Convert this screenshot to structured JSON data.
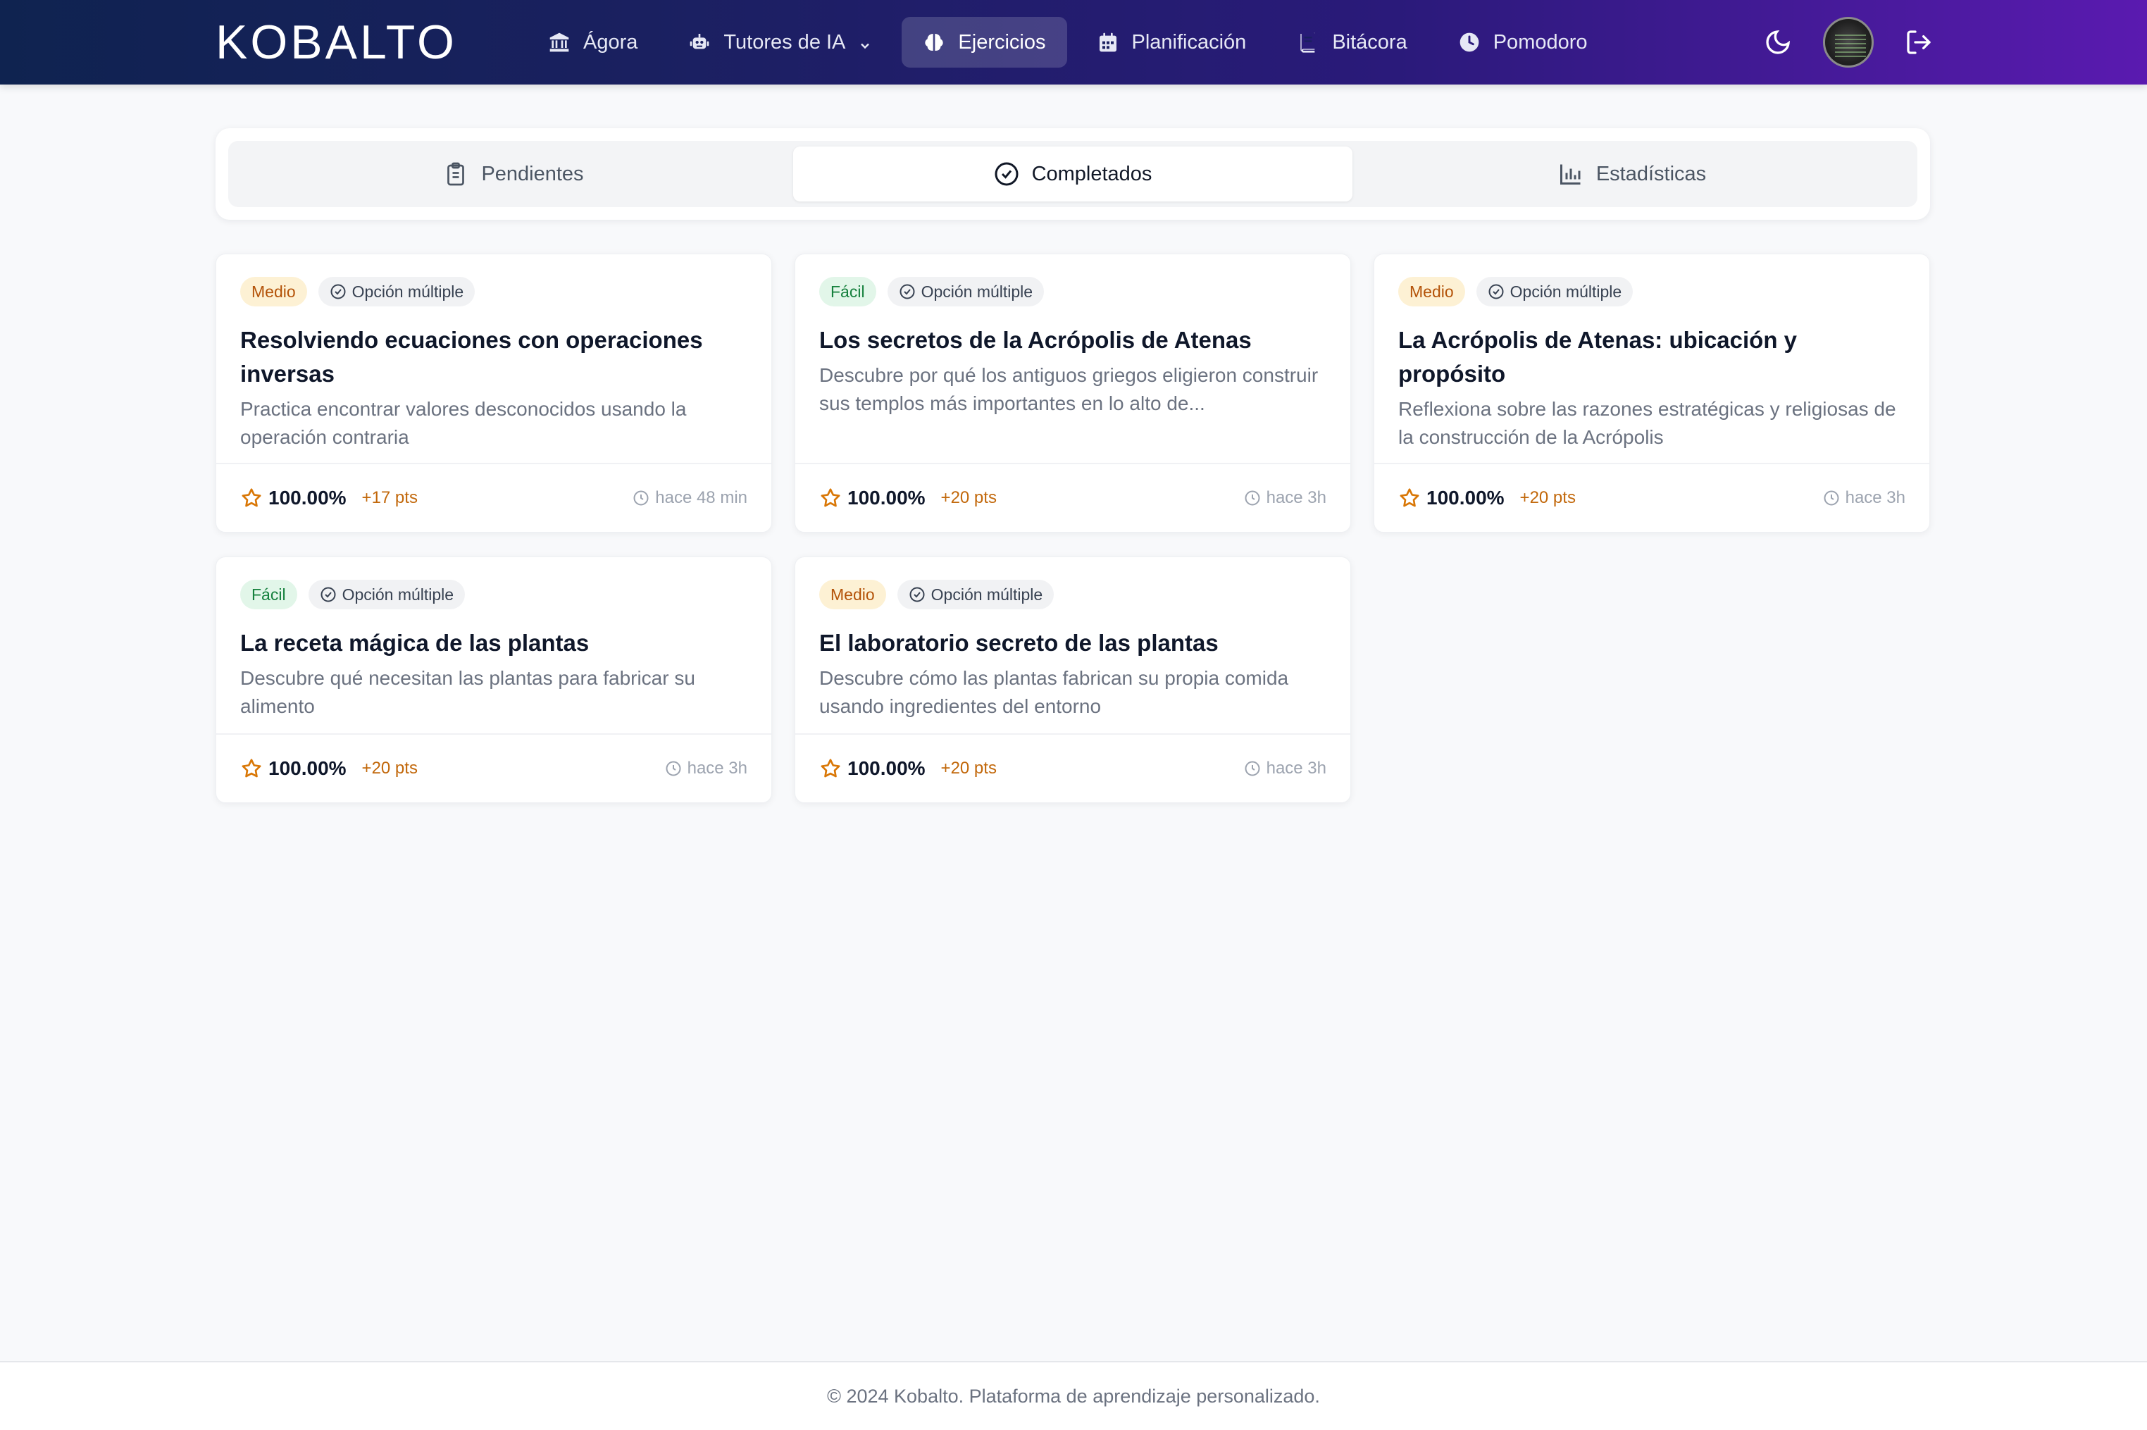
{
  "nav": {
    "logo": "KOBALTO",
    "items": [
      {
        "label": "Ágora",
        "icon": "bank-icon"
      },
      {
        "label": "Tutores de IA",
        "icon": "robot-icon"
      },
      {
        "label": "Ejercicios",
        "icon": "brain-icon",
        "active": true
      },
      {
        "label": "Planificación",
        "icon": "calendar-icon"
      },
      {
        "label": "Bitácora",
        "icon": "book-icon"
      },
      {
        "label": "Pomodoro",
        "icon": "clock-icon"
      }
    ],
    "right": [
      "moon-icon",
      "avatar",
      "logout-icon"
    ]
  },
  "tabs": [
    {
      "label": "Pendientes",
      "icon": "clipboard-icon"
    },
    {
      "label": "Completados",
      "icon": "check-circle-icon",
      "active": true
    },
    {
      "label": "Estadísticas",
      "icon": "bar-chart-icon"
    }
  ],
  "cards": [
    {
      "difficulty": "Medio",
      "type": "Opción múltiple",
      "title": "Resolviendo ecuaciones con operaciones inversas",
      "description": "Practica encontrar valores desconocidos usando la operación contraria",
      "score": "100.00%",
      "points": "+17 pts",
      "time": "hace 48 min"
    },
    {
      "difficulty": "Fácil",
      "type": "Opción múltiple",
      "title": "Los secretos de la Acrópolis de Atenas",
      "description": "Descubre por qué los antiguos griegos eligieron construir sus templos más importantes en lo alto de...",
      "score": "100.00%",
      "points": "+20 pts",
      "time": "hace 3h"
    },
    {
      "difficulty": "Medio",
      "type": "Opción múltiple",
      "title": "La Acrópolis de Atenas: ubicación y propósito",
      "description": "Reflexiona sobre las razones estratégicas y religiosas de la construcción de la Acrópolis",
      "score": "100.00%",
      "points": "+20 pts",
      "time": "hace 3h"
    },
    {
      "difficulty": "Fácil",
      "type": "Opción múltiple",
      "title": "La receta mágica de las plantas",
      "description": "Descubre qué necesitan las plantas para fabricar su alimento",
      "score": "100.00%",
      "points": "+20 pts",
      "time": "hace 3h"
    },
    {
      "difficulty": "Medio",
      "type": "Opción múltiple",
      "title": "El laboratorio secreto de las plantas",
      "description": "Descubre cómo las plantas fabrican su propia comida usando ingredientes del entorno",
      "score": "100.00%",
      "points": "+20 pts",
      "time": "hace 3h"
    }
  ],
  "footer": {
    "text": "© 2024 Kobalto. Plataforma de aprendizaje personalizado."
  },
  "colors": {
    "nav_start": "#0f2350",
    "nav_end": "#5a1ab0",
    "medio_bg": "#fdf1d4",
    "facil_bg": "#e2f6e9",
    "points": "#c2680b"
  }
}
